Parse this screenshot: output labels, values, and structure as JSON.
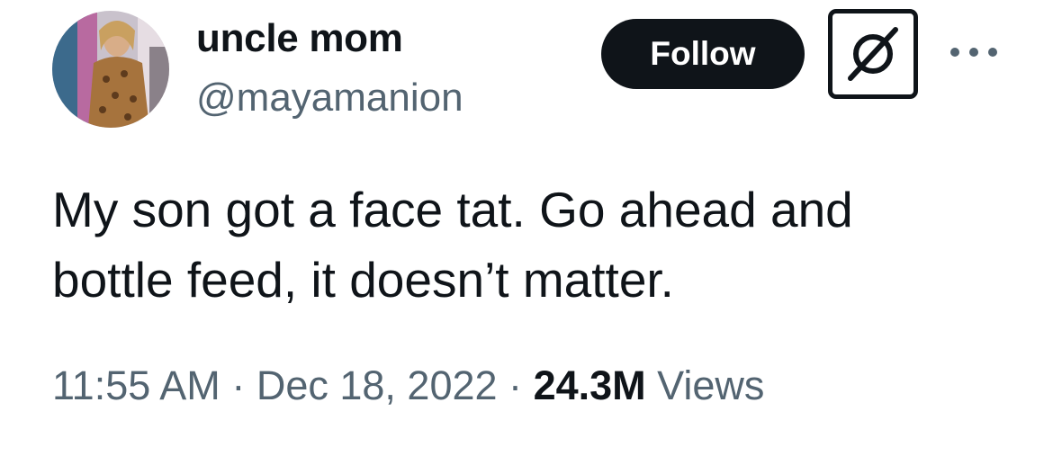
{
  "user": {
    "display_name": "uncle mom",
    "handle": "@mayamanion",
    "avatar_icon": "profile-photo"
  },
  "actions": {
    "follow_label": "Follow",
    "grok_icon": "grok-icon",
    "more_icon": "more-dots-icon"
  },
  "tweet": {
    "text_line1": "My son got a face tat. Go ahead and",
    "text_line2": "bottle feed, it doesn’t matter.",
    "time": "11:55 AM",
    "separator": "·",
    "date": "Dec 18, 2022",
    "views_count": "24.3M",
    "views_label": "Views"
  },
  "colors": {
    "text_primary": "#0f1419",
    "text_secondary": "#536471",
    "button_bg": "#0f1419",
    "button_text": "#ffffff"
  }
}
